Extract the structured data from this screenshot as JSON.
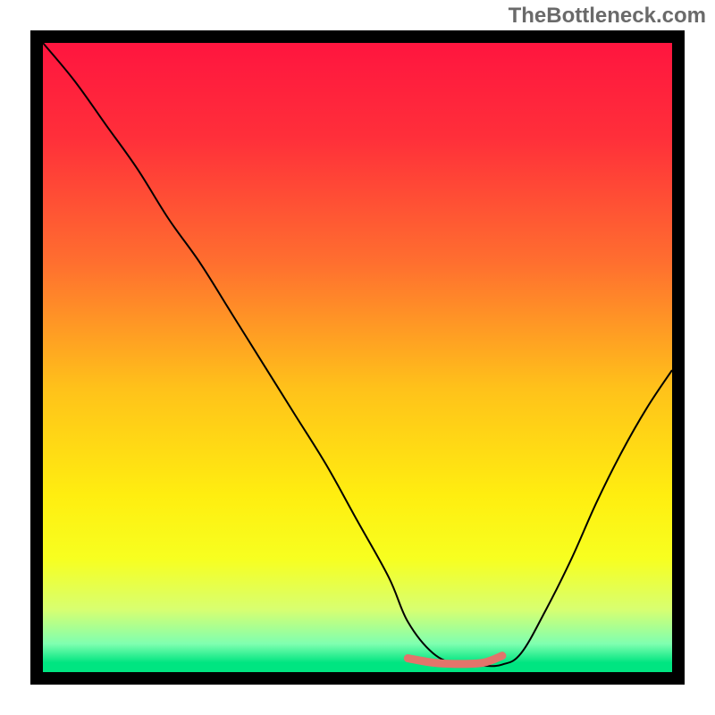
{
  "watermark": "TheBottleneck.com",
  "chart_data": {
    "type": "line",
    "title": "",
    "xlabel": "",
    "ylabel": "",
    "x_range": [
      0,
      100
    ],
    "y_range": [
      0,
      100
    ],
    "background_gradient": {
      "orientation": "vertical",
      "stops": [
        {
          "offset": 0.0,
          "color": "#ff153f"
        },
        {
          "offset": 0.15,
          "color": "#ff2f3a"
        },
        {
          "offset": 0.35,
          "color": "#ff6f2f"
        },
        {
          "offset": 0.55,
          "color": "#ffc21a"
        },
        {
          "offset": 0.72,
          "color": "#ffee10"
        },
        {
          "offset": 0.82,
          "color": "#f7ff20"
        },
        {
          "offset": 0.9,
          "color": "#d8ff70"
        },
        {
          "offset": 0.955,
          "color": "#7fffb0"
        },
        {
          "offset": 0.985,
          "color": "#00e581"
        },
        {
          "offset": 1.0,
          "color": "#00e581"
        }
      ]
    },
    "series": [
      {
        "name": "bottleneck-curve",
        "color": "#000000",
        "width": 2,
        "x": [
          0,
          5,
          10,
          15,
          20,
          25,
          30,
          35,
          40,
          45,
          50,
          55,
          58,
          62,
          66,
          70,
          73,
          76,
          80,
          84,
          88,
          92,
          96,
          100
        ],
        "y": [
          100,
          94,
          87,
          80,
          72,
          65,
          57,
          49,
          41,
          33,
          24,
          15,
          8,
          3,
          1.2,
          1.0,
          1.2,
          3,
          10,
          18,
          27,
          35,
          42,
          48
        ]
      },
      {
        "name": "optimal-range-marker",
        "color": "#e2746b",
        "width": 9,
        "linecap": "round",
        "x": [
          58,
          62,
          66,
          70,
          73
        ],
        "y": [
          2.2,
          1.5,
          1.3,
          1.5,
          2.6
        ]
      }
    ],
    "legend": null,
    "grid": false
  }
}
